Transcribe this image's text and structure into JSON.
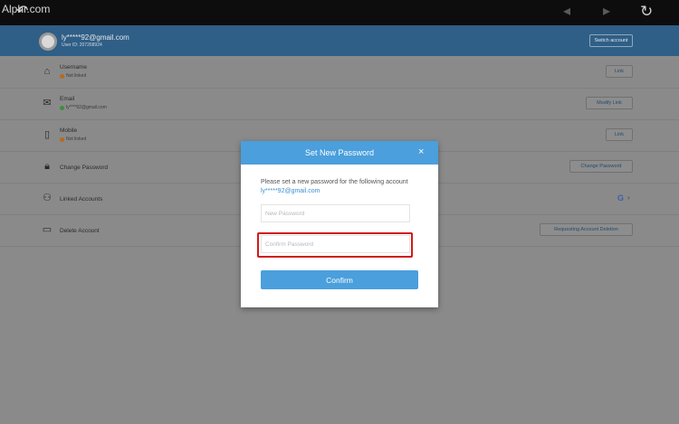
{
  "watermark": "Alphr.com",
  "toolbar": {
    "back_icon": "back-arrow-icon",
    "prev_icon": "diamond-left-icon",
    "next_icon": "diamond-right-icon",
    "refresh_icon": "refresh-icon"
  },
  "account": {
    "email": "ly*****92@gmail.com",
    "user_id": "User ID: 207268924",
    "switch_label": "Switch account"
  },
  "rows": [
    {
      "title": "Username",
      "status": "Not linked",
      "status_color": "orange",
      "button": "Link",
      "icon": "username-icon"
    },
    {
      "title": "Email",
      "status": "ly****92@gmail.com",
      "status_color": "green",
      "button": "Modify Link",
      "icon": "email-icon"
    },
    {
      "title": "Mobile",
      "status": "Not linked",
      "status_color": "orange",
      "button": "Link",
      "icon": "mobile-icon"
    },
    {
      "title": "Change Password",
      "button": "Change Password",
      "icon": "lock-icon"
    },
    {
      "title": "Linked Accounts",
      "icon": "linked-accounts-icon",
      "google_icon": "G"
    },
    {
      "title": "Delete Account",
      "button": "Requesting Account Deletion",
      "icon": "delete-account-icon"
    }
  ],
  "modal": {
    "title": "Set New Password",
    "close": "×",
    "description": "Please set a new password for the following account",
    "email": "ly*****92@gmail.com",
    "new_password_placeholder": "New Password",
    "confirm_password_placeholder": "Confirm Password",
    "confirm_label": "Confirm"
  },
  "colors": {
    "header_blue": "#4a9fdc",
    "highlight_red": "#d11a1a",
    "link_blue": "#3a8fd2"
  }
}
